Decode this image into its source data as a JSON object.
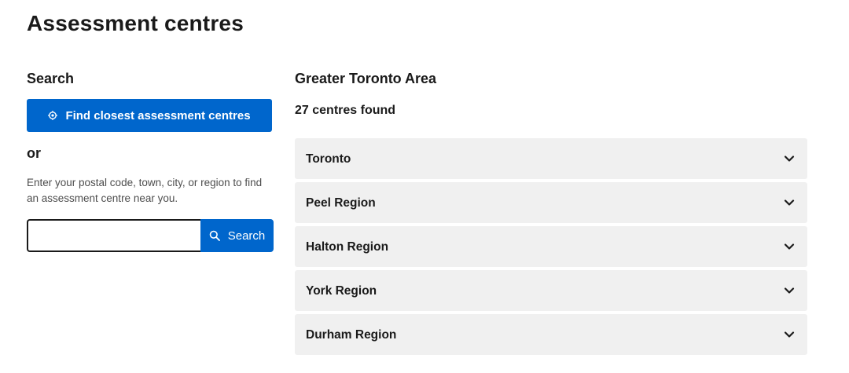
{
  "page": {
    "title": "Assessment centres"
  },
  "search_panel": {
    "heading": "Search",
    "find_button_label": "Find closest assessment centres",
    "or_label": "or",
    "help_text": "Enter your postal code, town, city, or region to find an assessment centre near you.",
    "input_value": "",
    "search_button_label": "Search"
  },
  "results": {
    "area_heading": "Greater Toronto Area",
    "count_text": "27 centres found",
    "regions": [
      {
        "label": "Toronto",
        "icon": "chevron-down-icon"
      },
      {
        "label": "Peel Region",
        "icon": "chevron-down-icon"
      },
      {
        "label": "Halton Region",
        "icon": "chevron-down-icon"
      },
      {
        "label": "York Region",
        "icon": "chevron-down-icon"
      },
      {
        "label": "Durham Region",
        "icon": "chevron-down-icon"
      }
    ]
  },
  "colors": {
    "primary": "#0066cc",
    "accordion_bg": "#f0f0f0",
    "text": "#1a1a1a"
  }
}
